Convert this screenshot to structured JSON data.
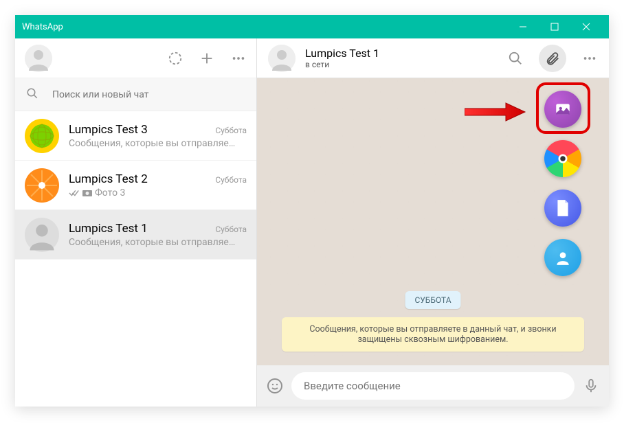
{
  "window": {
    "title": "WhatsApp"
  },
  "sidebar": {
    "search_placeholder": "Поиск или новый чат",
    "chats": [
      {
        "name": "Lumpics Test 3",
        "time": "Суббота",
        "preview": "Сообщения, которые вы отправляе…",
        "avatar_bg": "#ffd200",
        "avatar_inner": "#7cd100"
      },
      {
        "name": "Lumpics Test 2",
        "time": "Суббота",
        "preview": "Фото 3",
        "has_checks": true,
        "has_camera": true,
        "avatar_bg": "#ff9a2b",
        "avatar_inner": "#ffb850"
      },
      {
        "name": "Lumpics Test 1",
        "time": "Суббота",
        "preview": "Сообщения, которые вы отправляе…",
        "avatar_bg": "#eee",
        "active": true
      }
    ]
  },
  "main": {
    "contact_name": "Lumpics Test 1",
    "status": "в сети",
    "date_chip": "СУББОТА",
    "encryption": "Сообщения, которые вы отправляете в данный чат, и звонки защищены сквозным шифрованием.",
    "composer_placeholder": "Введите сообщение"
  },
  "attach": {
    "gallery": "#8e44ad",
    "camera": "#ff6b6b",
    "document": "#5569ff",
    "contact": "#1ea0e6"
  }
}
